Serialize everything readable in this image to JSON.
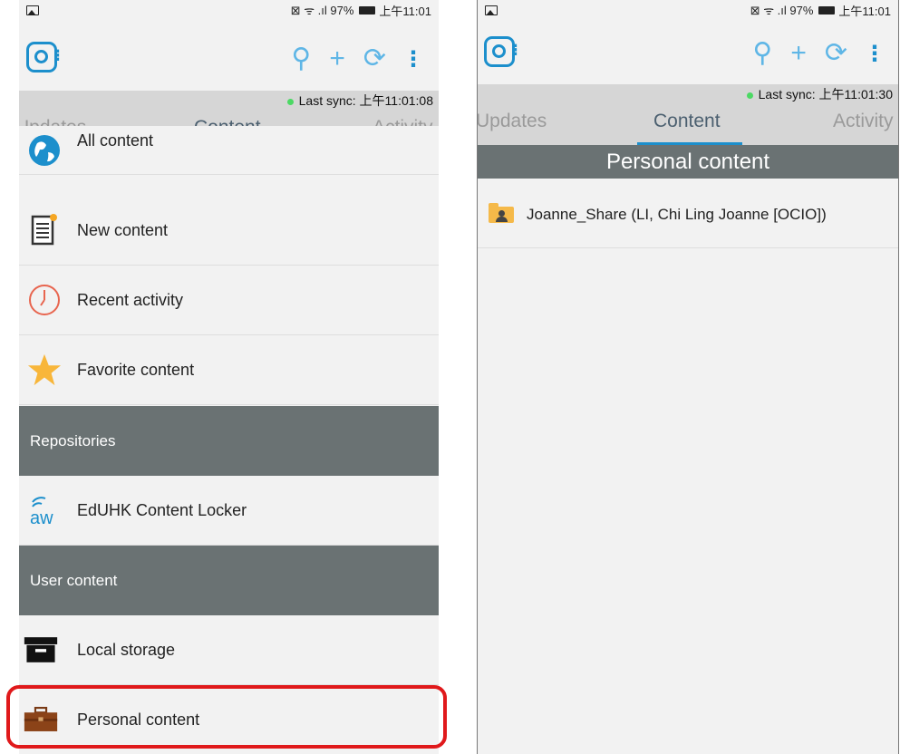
{
  "left_screen": {
    "status": {
      "signal": "⊠ ᯤ .ıl 97%",
      "time": "上午11:01"
    },
    "sync_text": "Last sync: 上午11:01:08",
    "tabs": [
      {
        "label": "Updates"
      },
      {
        "label": "Content",
        "active": true
      },
      {
        "label": "Activity"
      }
    ],
    "items": [
      {
        "label": "All content",
        "icon": "globe-icon"
      },
      {
        "label": "New content",
        "icon": "new-document-icon"
      },
      {
        "label": "Recent activity",
        "icon": "clock-icon"
      },
      {
        "label": "Favorite content",
        "icon": "star-icon"
      }
    ],
    "repositories_header": "Repositories",
    "repository_item": {
      "label": "EdUHK Content Locker",
      "icon": "aw-icon",
      "icon_text": "aw"
    },
    "user_content_header": "User content",
    "user_items": [
      {
        "label": "Local storage",
        "icon": "archive-box-icon"
      },
      {
        "label": "Personal content",
        "icon": "briefcase-icon"
      }
    ]
  },
  "right_screen": {
    "status": {
      "signal": "⊠ ᯤ .ıl 97%",
      "time": "上午11:01"
    },
    "sync_text": "Last sync: 上午11:01:30",
    "tabs": [
      {
        "label": "Updates"
      },
      {
        "label": "Content",
        "active": true
      },
      {
        "label": "Activity"
      }
    ],
    "header": "Personal content",
    "items": [
      {
        "label": "Joanne_Share (LI, Chi Ling Joanne [OCIO])",
        "icon": "shared-folder-icon"
      }
    ]
  },
  "colors": {
    "accent": "#1c8fcc",
    "section_bg": "#6a7273",
    "tab_bar_bg": "#d6d6d6",
    "highlight": "#e0191b"
  }
}
